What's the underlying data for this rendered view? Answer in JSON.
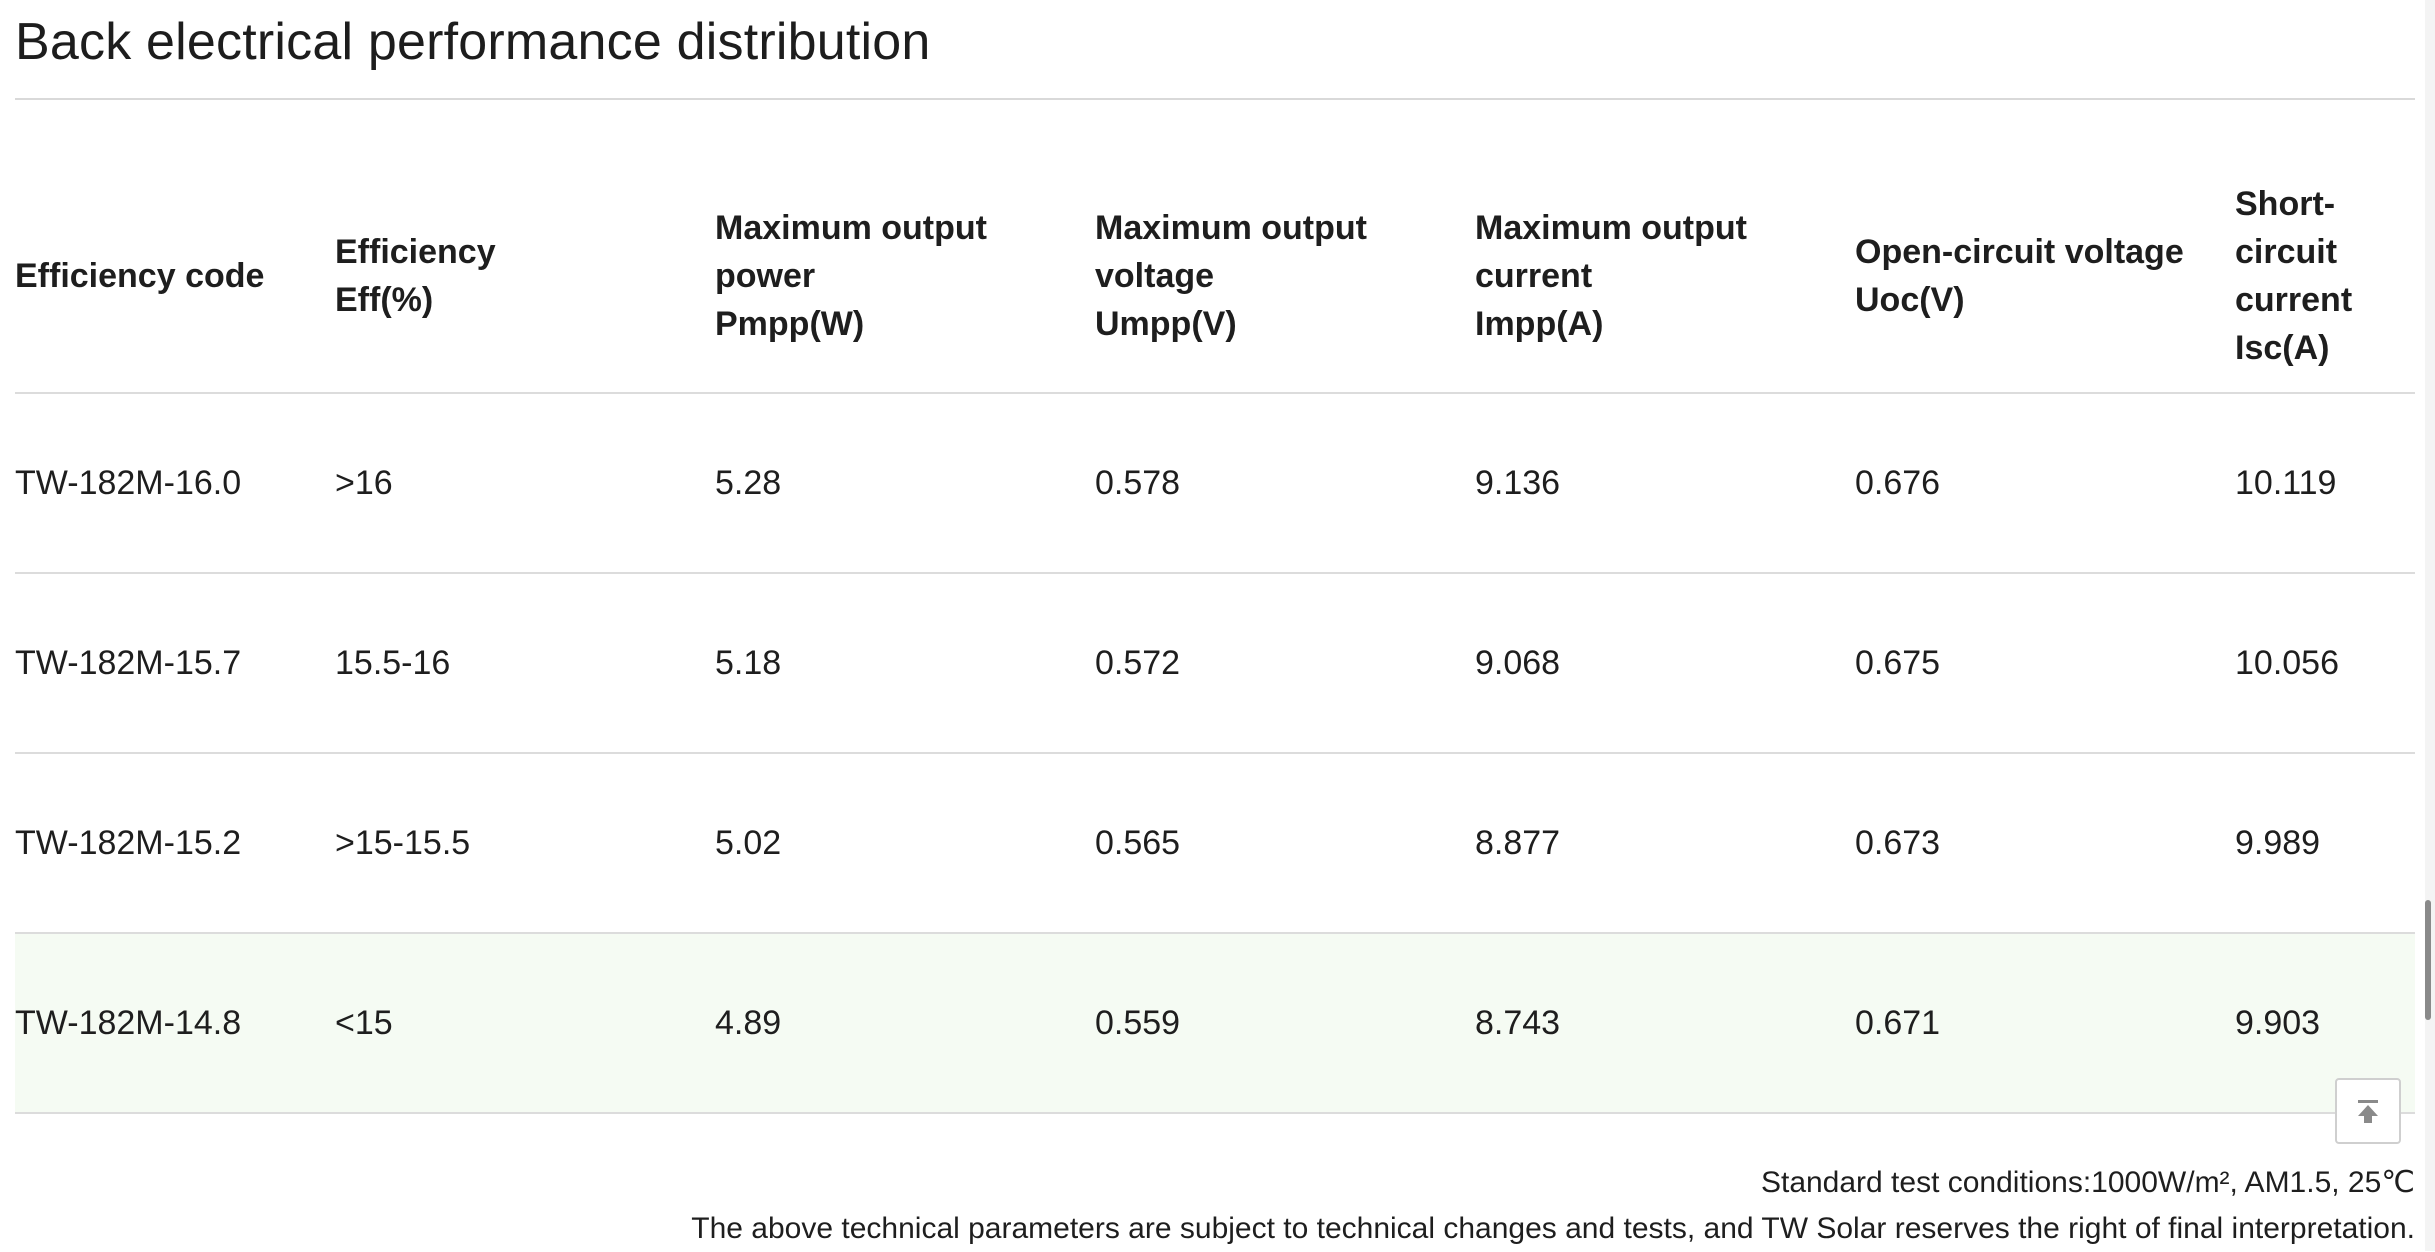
{
  "title": "Back electrical performance distribution",
  "table": {
    "headers": [
      "Efficiency code",
      "Efficiency\nEff(%)",
      "Maximum output\npower\nPmpp(W)",
      "Maximum output\nvoltage\nUmpp(V)",
      "Maximum output\ncurrent\nImpp(A)",
      "Open-circuit voltage\nUoc(V)",
      "Short-\ncircuit\ncurrent\nIsc(A)"
    ],
    "rows": [
      [
        "TW-182M-16.0",
        ">16",
        "5.28",
        "0.578",
        "9.136",
        "0.676",
        "10.119"
      ],
      [
        "TW-182M-15.7",
        "15.5-16",
        "5.18",
        "0.572",
        "9.068",
        "0.675",
        "10.056"
      ],
      [
        "TW-182M-15.2",
        ">15-15.5",
        "5.02",
        "0.565",
        "8.877",
        "0.673",
        "9.989"
      ],
      [
        "TW-182M-14.8",
        "<15",
        "4.89",
        "0.559",
        "8.743",
        "0.671",
        "9.903"
      ]
    ],
    "highlight_row_color": "#f5fbf3"
  },
  "notes": {
    "line1": "Standard test conditions:1000W/m², AM1.5, 25℃",
    "line2": "The above technical parameters are subject to technical changes and tests, and TW Solar reserves the right of final interpretation."
  },
  "back_to_top": {
    "icon": "arrow-up-to-line-icon"
  }
}
